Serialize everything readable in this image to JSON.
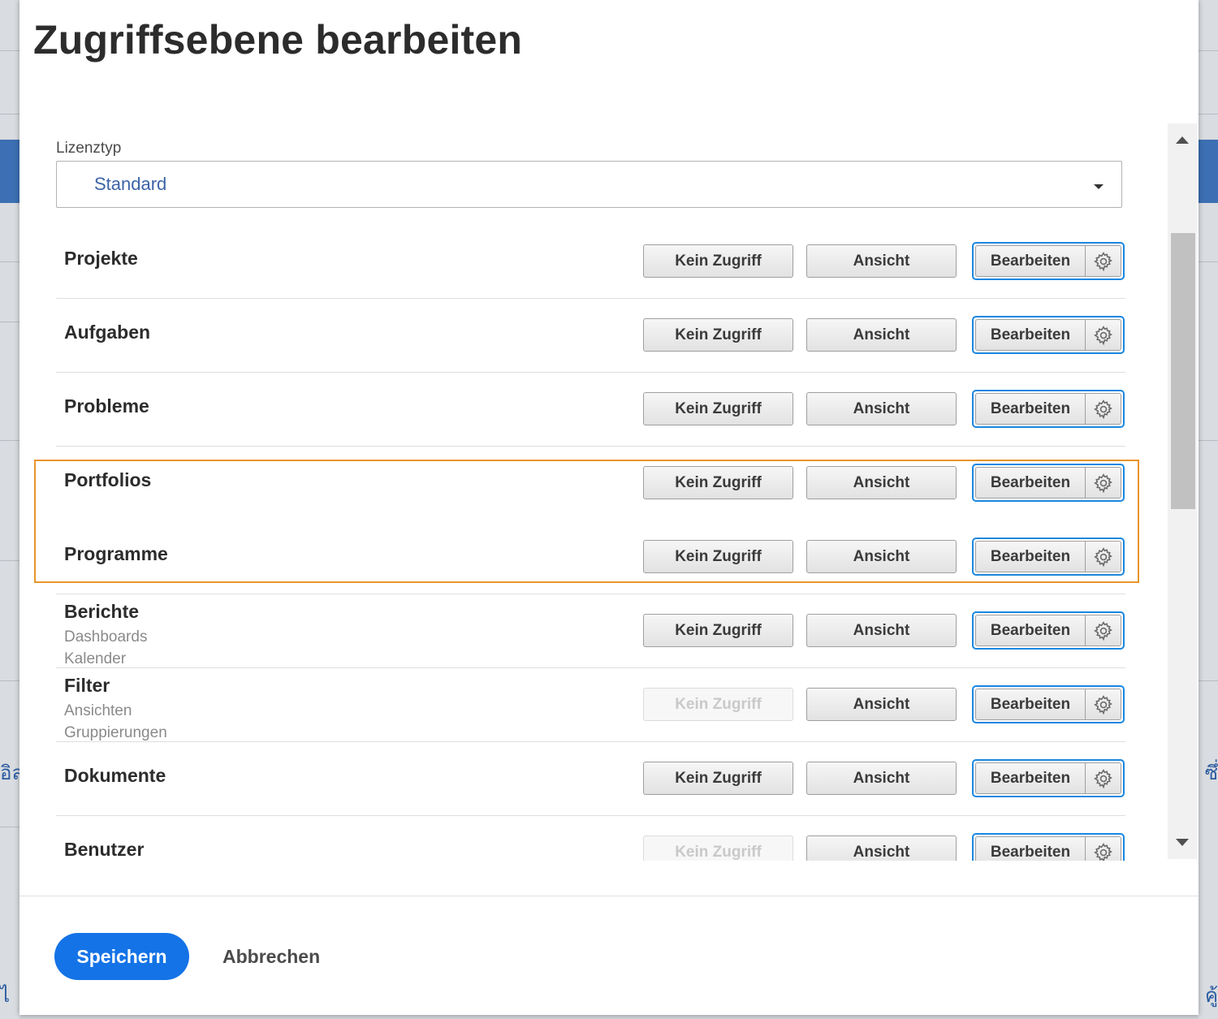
{
  "background": {
    "left_glyph_1": "อิล",
    "left_glyph_2": "ไ",
    "right_glyph_1": "ซึ่",
    "right_glyph_2": "คู้"
  },
  "dialog": {
    "title": "Zugriffsebene bearbeiten",
    "license": {
      "label": "Lizenztyp",
      "value": "Standard"
    },
    "buttons": {
      "no_access": "Kein Zugriff",
      "view": "Ansicht",
      "edit": "Bearbeiten"
    },
    "rows": [
      {
        "label": "Projekte",
        "sub": [],
        "no_access_enabled": true
      },
      {
        "label": "Aufgaben",
        "sub": [],
        "no_access_enabled": true
      },
      {
        "label": "Probleme",
        "sub": [],
        "no_access_enabled": true
      },
      {
        "label": "Portfolios",
        "sub": [],
        "no_access_enabled": true
      },
      {
        "label": "Programme",
        "sub": [],
        "no_access_enabled": true
      },
      {
        "label": "Berichte",
        "sub": [
          "Dashboards",
          "Kalender"
        ],
        "no_access_enabled": true
      },
      {
        "label": "Filter",
        "sub": [
          "Ansichten",
          "Gruppierungen"
        ],
        "no_access_enabled": false
      },
      {
        "label": "Dokumente",
        "sub": [],
        "no_access_enabled": true
      },
      {
        "label": "Benutzer",
        "sub": [],
        "no_access_enabled": false
      }
    ],
    "highlight_color": "#e8952b",
    "accent_color": "#1473e6",
    "footer": {
      "save_label": "Speichern",
      "cancel_label": "Abbrechen"
    }
  }
}
